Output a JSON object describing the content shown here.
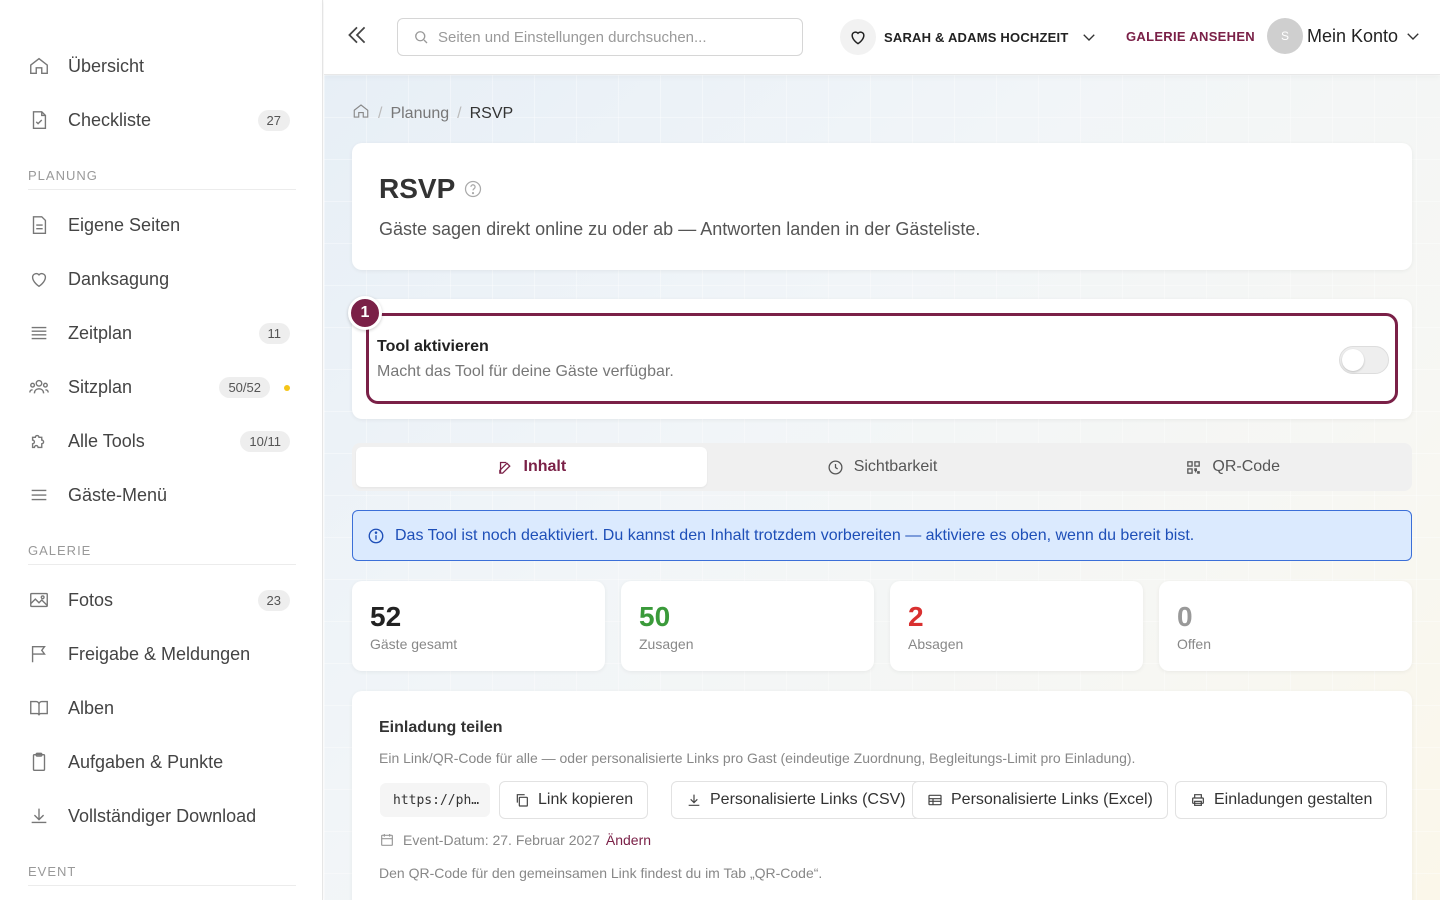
{
  "sidebar": {
    "items": [
      {
        "label": "Übersicht"
      },
      {
        "label": "Checkliste",
        "badge": "27"
      },
      {
        "label": "Eigene Seiten"
      },
      {
        "label": "Danksagung"
      },
      {
        "label": "Zeitplan",
        "badge": "11"
      },
      {
        "label": "Sitzplan",
        "badge": "50/52"
      },
      {
        "label": "Alle Tools",
        "badge": "10/11"
      },
      {
        "label": "Gäste-Menü"
      },
      {
        "label": "Fotos",
        "badge": "23"
      },
      {
        "label": "Freigabe & Meldungen"
      },
      {
        "label": "Alben"
      },
      {
        "label": "Aufgaben & Punkte"
      },
      {
        "label": "Vollständiger Download"
      }
    ],
    "sections": {
      "planning": "PLANUNG",
      "gallery": "GALERIE",
      "event": "EVENT"
    },
    "indicator_color": "#f5c518"
  },
  "header": {
    "search_placeholder": "Seiten und Einstellungen durchsuchen...",
    "event_name": "SARAH & ADAMS HOCHZEIT",
    "gallery_link": "GALERIE ANSEHEN",
    "avatar_initial": "S",
    "account_label": "Mein Konto"
  },
  "breadcrumb": {
    "parent": "Planung",
    "current": "RSVP"
  },
  "page": {
    "title": "RSVP",
    "description": "Gäste sagen direkt online zu oder ab — Antworten landen in der Gästeliste."
  },
  "toggle": {
    "step": "1",
    "title": "Tool aktivieren",
    "description": "Macht das Tool für deine Gäste verfügbar.",
    "enabled": false
  },
  "tabs": [
    {
      "label": "Inhalt",
      "active": true
    },
    {
      "label": "Sichtbarkeit",
      "active": false
    },
    {
      "label": "QR-Code",
      "active": false
    }
  ],
  "info": "Das Tool ist noch deaktiviert. Du kannst den Inhalt trotzdem vorbereiten — aktiviere es oben, wenn du bereit bist.",
  "stats": [
    {
      "value": "52",
      "label": "Gäste gesamt",
      "color": "#222222"
    },
    {
      "value": "50",
      "label": "Zusagen",
      "color": "#3a9a3a"
    },
    {
      "value": "2",
      "label": "Absagen",
      "color": "#d93030"
    },
    {
      "value": "0",
      "label": "Offen",
      "color": "#999999"
    }
  ],
  "share": {
    "title": "Einladung teilen",
    "description": "Ein Link/QR-Code für alle — oder personalisierte Links pro Gast (eindeutige Zuordnung, Begleitungs-Limit pro Einladung).",
    "url_preview": "https://ph…",
    "buttons": {
      "copy": "Link kopieren",
      "csv": "Personalisierte Links (CSV)",
      "excel": "Personalisierte Links (Excel)",
      "design": "Einladungen gestalten"
    },
    "event_date": "Event-Datum: 27. Februar 2027",
    "change": "Ändern",
    "note": "Den QR-Code für den gemeinsamen Link findest du im Tab „QR-Code“."
  },
  "colors": {
    "accent": "#7a2047",
    "info_bg": "#dbeafe",
    "info_text": "#1e4fb8"
  }
}
